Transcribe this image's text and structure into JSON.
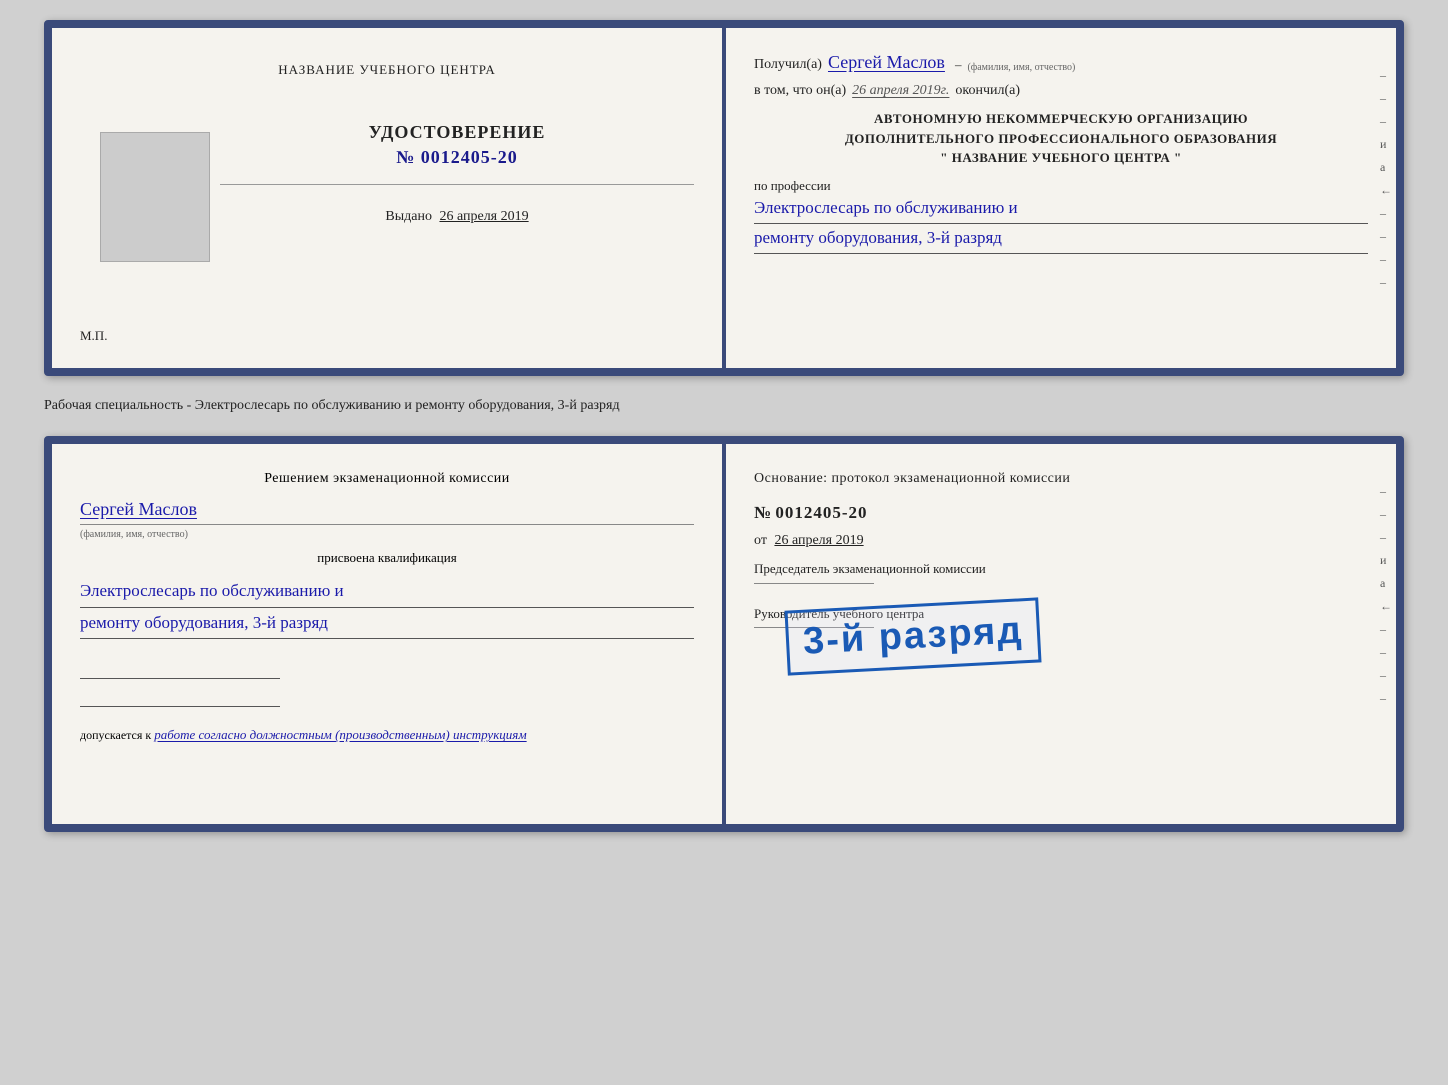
{
  "card1": {
    "left": {
      "center_title": "НАЗВАНИЕ УЧЕБНОГО ЦЕНТРА",
      "udostoverenie_label": "УДОСТОВЕРЕНИЕ",
      "num_prefix": "№",
      "num_value": "0012405-20",
      "issued_label": "Выдано",
      "issued_date": "26 апреля 2019",
      "mp_label": "М.П."
    },
    "right": {
      "received_label": "Получил(а)",
      "received_name": "Сергей Маслов",
      "name_hint": "(фамилия, имя, отчество)",
      "vtom_label": "в том, что он(а)",
      "vtom_date": "26 апреля 2019г.",
      "okonchil_label": "окончил(а)",
      "org_line1": "АВТОНОМНУЮ НЕКОММЕРЧЕСКУЮ ОРГАНИЗАЦИЮ",
      "org_line2": "ДОПОЛНИТЕЛЬНОГО ПРОФЕССИОНАЛЬНОГО ОБРАЗОВАНИЯ",
      "org_line3": "\"    НАЗВАНИЕ УЧЕБНОГО ЦЕНТРА    \"",
      "po_professii": "по профессии",
      "profession1": "Электрослесарь по обслуживанию и",
      "profession2": "ремонту оборудования, 3-й разряд"
    }
  },
  "between_label": "Рабочая специальность - Электрослесарь по обслуживанию и ремонту оборудования, 3-й разряд",
  "card2": {
    "left": {
      "komissia_title1": "Решением экзаменационной комиссии",
      "name_handwritten": "Сергей Маслов",
      "name_hint": "(фамилия, имя, отчество)",
      "prisvoyena": "присвоена квалификация",
      "qual1": "Электрослесарь по обслуживанию и",
      "qual2": "ремонту оборудования, 3-й разряд",
      "dopuskaetsya_label": "допускается к",
      "dopuskaetsya_val": "работе согласно должностным (производственным) инструкциям"
    },
    "right": {
      "osnov_label": "Основание: протокол экзаменационной комиссии",
      "num_prefix": "№",
      "num_value": "0012405-20",
      "ot_label": "от",
      "ot_date": "26 апреля 2019",
      "chairman_label": "Председатель экзаменационной комиссии",
      "rukov_label": "Руководитель учебного центра"
    },
    "stamp": {
      "text": "3-й разряд"
    }
  }
}
